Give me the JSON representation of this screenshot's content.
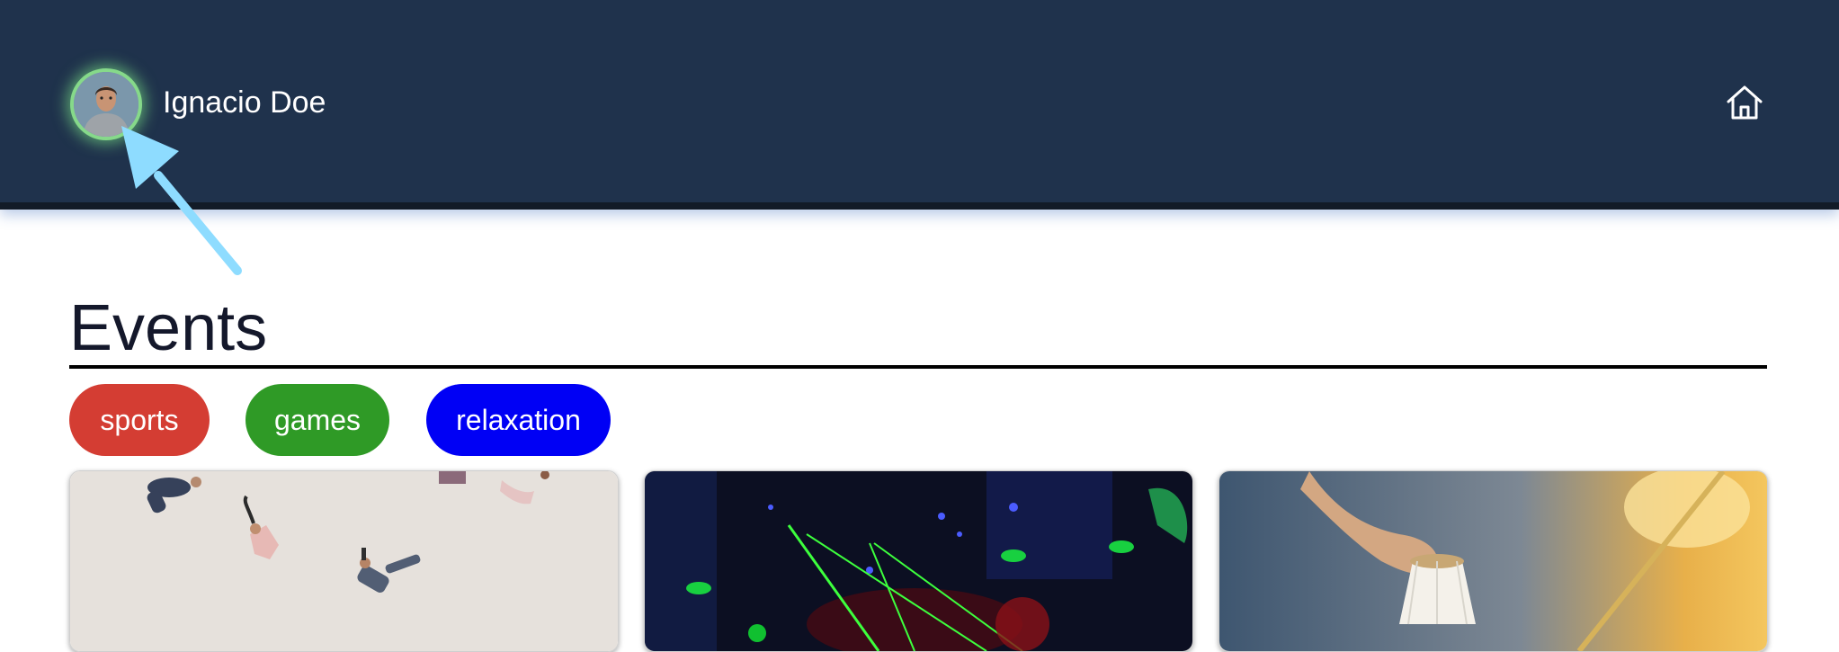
{
  "header": {
    "user_name": "Ignacio Doe",
    "avatar_icon": "user-avatar-icon",
    "home_icon": "home-icon",
    "background": "#1f324c"
  },
  "main": {
    "title": "Events",
    "categories": [
      {
        "label": "sports",
        "color": "#d43d33"
      },
      {
        "label": "games",
        "color": "#2f9a26"
      },
      {
        "label": "relaxation",
        "color": "#0000f5"
      }
    ],
    "cards": [
      {
        "image": "falling-people-image"
      },
      {
        "image": "laser-party-image"
      },
      {
        "image": "badminton-shuttlecock-image"
      }
    ]
  },
  "annotation": {
    "arrow_icon": "pointer-arrow-icon",
    "color": "#8edcff"
  }
}
